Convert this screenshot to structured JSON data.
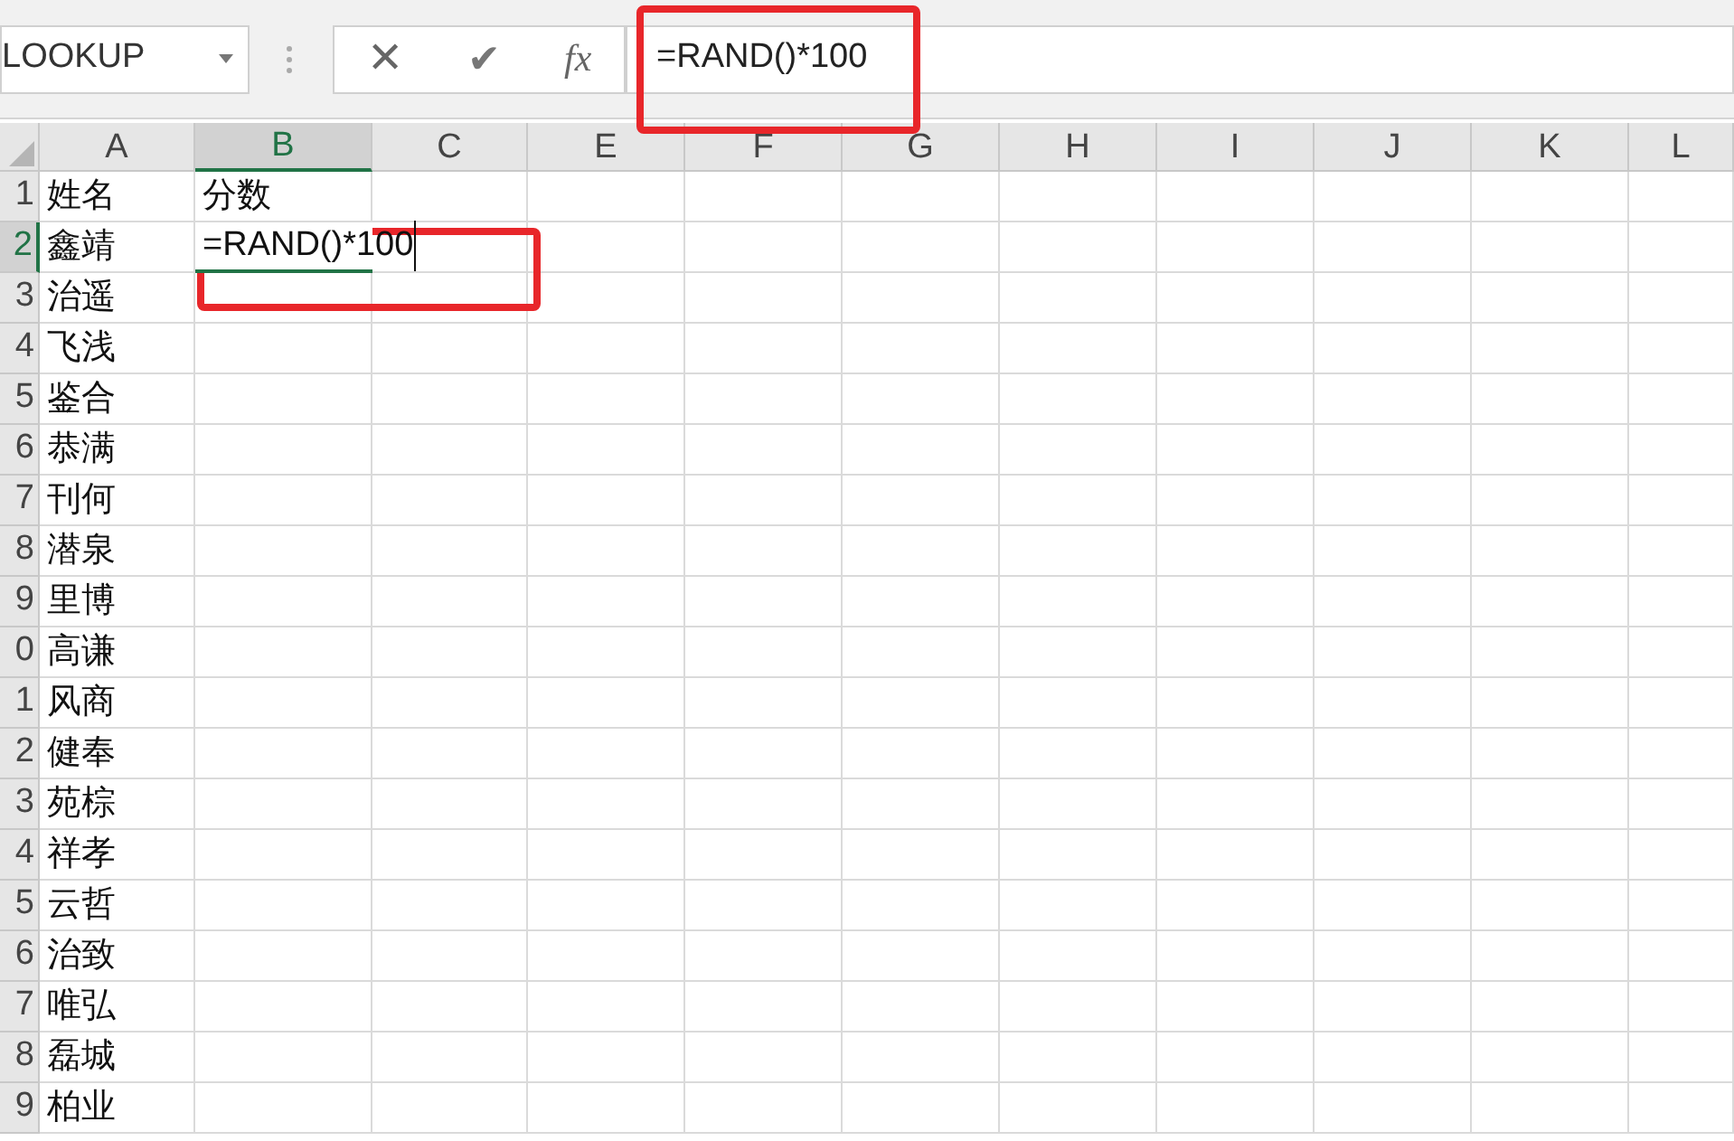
{
  "name_box": {
    "value": "LOOKUP"
  },
  "formula_bar": {
    "cancel": "✕",
    "enter": "✔",
    "function": "fx",
    "value": "=RAND()*100"
  },
  "columns": [
    {
      "label": "A",
      "selected": false
    },
    {
      "label": "B",
      "selected": true
    },
    {
      "label": "C",
      "selected": false
    },
    {
      "label": "E",
      "selected": false
    },
    {
      "label": "F",
      "selected": false
    },
    {
      "label": "G",
      "selected": false
    },
    {
      "label": "H",
      "selected": false
    },
    {
      "label": "I",
      "selected": false
    },
    {
      "label": "J",
      "selected": false
    },
    {
      "label": "K",
      "selected": false
    },
    {
      "label": "L",
      "selected": false
    }
  ],
  "rows": [
    {
      "header": "1",
      "selected": false,
      "a": "姓名",
      "b": "分数"
    },
    {
      "header": "2",
      "selected": true,
      "a": "鑫靖",
      "b": "=RAND()*100",
      "editing": true
    },
    {
      "header": "3",
      "selected": false,
      "a": "治遥"
    },
    {
      "header": "4",
      "selected": false,
      "a": "飞浅"
    },
    {
      "header": "5",
      "selected": false,
      "a": "鉴合"
    },
    {
      "header": "6",
      "selected": false,
      "a": "恭满"
    },
    {
      "header": "7",
      "selected": false,
      "a": "刊何"
    },
    {
      "header": "8",
      "selected": false,
      "a": "潜泉"
    },
    {
      "header": "9",
      "selected": false,
      "a": "里博"
    },
    {
      "header": "0",
      "selected": false,
      "a": "高谦"
    },
    {
      "header": "1",
      "selected": false,
      "a": "风商"
    },
    {
      "header": "2",
      "selected": false,
      "a": "健奉"
    },
    {
      "header": "3",
      "selected": false,
      "a": "苑棕"
    },
    {
      "header": "4",
      "selected": false,
      "a": "祥孝"
    },
    {
      "header": "5",
      "selected": false,
      "a": "云哲"
    },
    {
      "header": "6",
      "selected": false,
      "a": "治致"
    },
    {
      "header": "7",
      "selected": false,
      "a": "唯弘"
    },
    {
      "header": "8",
      "selected": false,
      "a": "磊城"
    },
    {
      "header": "9",
      "selected": false,
      "a": "柏业"
    }
  ]
}
